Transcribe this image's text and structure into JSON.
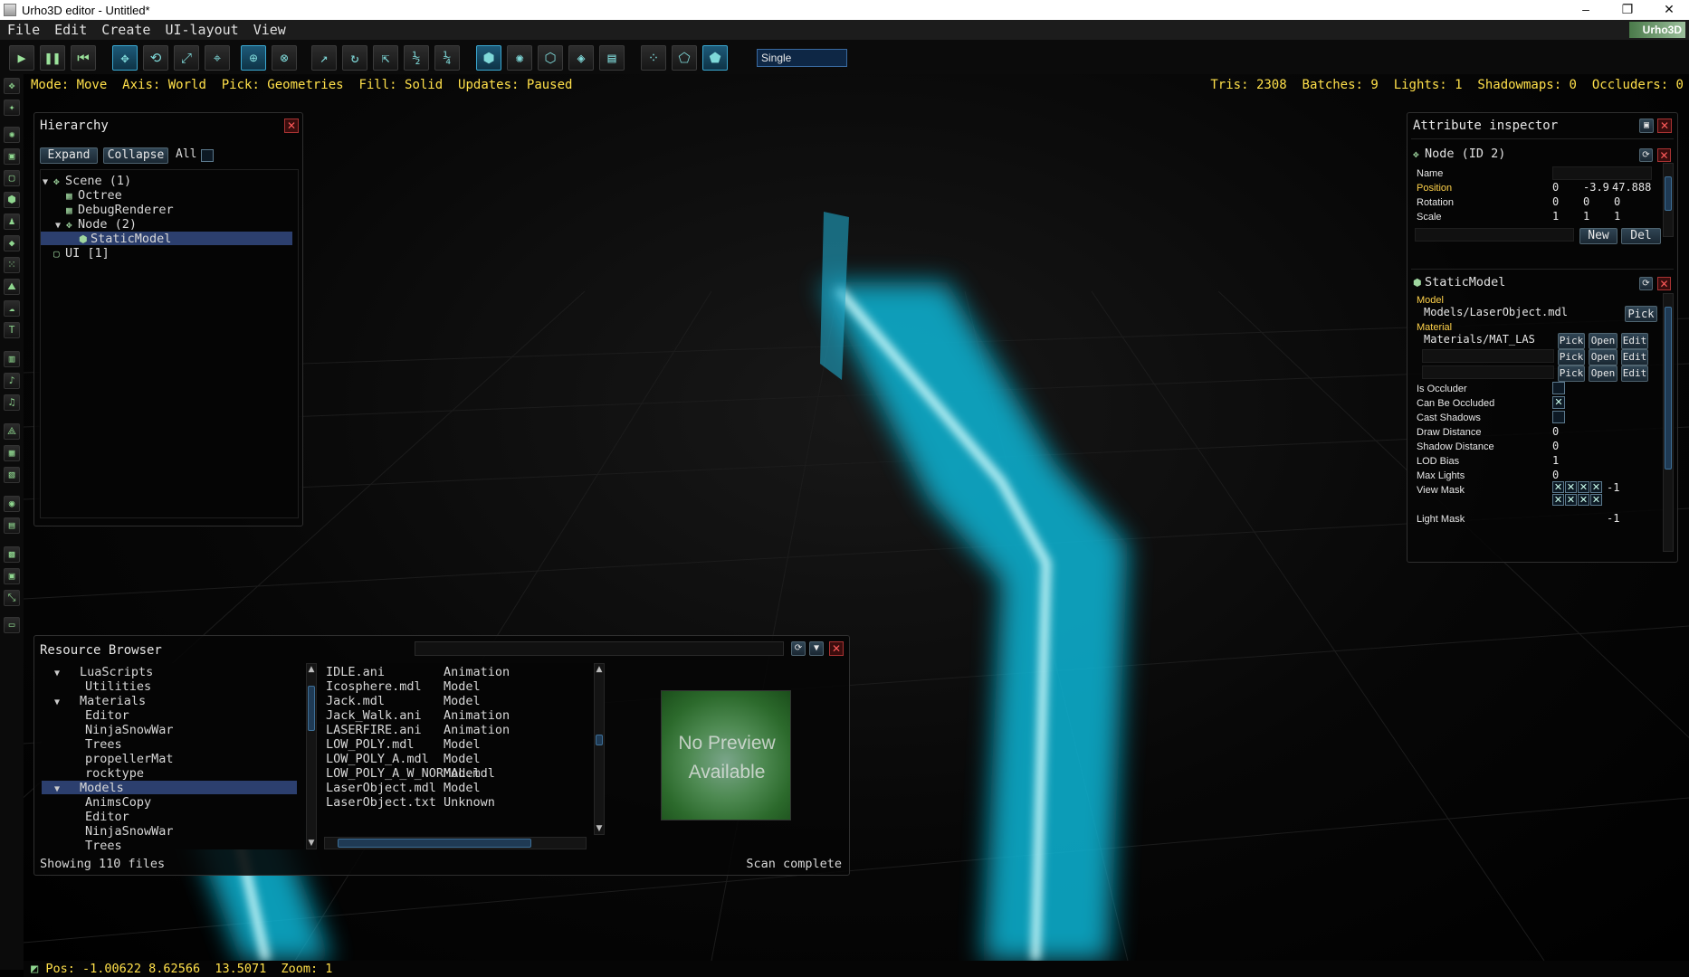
{
  "window": {
    "title": "Urho3D editor - Untitled*",
    "minimize": "–",
    "maximize": "❐",
    "close": "✕"
  },
  "menu": [
    "File",
    "Edit",
    "Create",
    "UI-layout",
    "View"
  ],
  "logo": "Urho3D",
  "toolbar": {
    "view_mode": "Single"
  },
  "status": {
    "mode": "Mode: Move",
    "axis": "Axis: World",
    "pick": "Pick: Geometries",
    "fill": "Fill: Solid",
    "updates": "Updates: Paused",
    "tris": "Tris: 2308",
    "batches": "Batches: 9",
    "lights": "Lights: 1",
    "shadowmaps": "Shadowmaps: 0",
    "occluders": "Occluders: 0"
  },
  "hierarchy": {
    "title": "Hierarchy",
    "expand": "Expand",
    "collapse": "Collapse",
    "all": "All",
    "items": [
      {
        "label": "Scene (1)",
        "icon": "scene-node-icon",
        "indent": 0,
        "expanded": true
      },
      {
        "label": "Octree",
        "icon": "component-icon",
        "indent": 1
      },
      {
        "label": "DebugRenderer",
        "icon": "component-icon",
        "indent": 1
      },
      {
        "label": "Node (2)",
        "icon": "node-icon",
        "indent": 1,
        "expanded": true
      },
      {
        "label": "StaticModel",
        "icon": "static-model-icon",
        "indent": 2,
        "selected": true
      },
      {
        "label": "UI [1]",
        "icon": "ui-element-icon",
        "indent": 0
      }
    ]
  },
  "inspector": {
    "title": "Attribute inspector",
    "node": {
      "title": "Node (ID 2)",
      "name_label": "Name",
      "name_value": "",
      "position_label": "Position",
      "position": [
        "0",
        "-3.9",
        "47.888"
      ],
      "rotation_label": "Rotation",
      "rotation": [
        "0",
        "0",
        "0"
      ],
      "scale_label": "Scale",
      "scale": [
        "1",
        "1",
        "1"
      ],
      "new": "New",
      "del": "Del"
    },
    "static_model": {
      "title": "StaticModel",
      "model_label": "Model",
      "model_value": "Models/LaserObject.mdl",
      "material_label": "Material",
      "material_value": "Materials/MAT_LAS",
      "pick": "Pick",
      "open": "Open",
      "edit": "Edit",
      "is_occluder": "Is Occluder",
      "is_occluder_checked": false,
      "can_be_occluded": "Can Be Occluded",
      "can_be_occluded_checked": true,
      "cast_shadows": "Cast Shadows",
      "cast_shadows_checked": false,
      "draw_distance": "Draw Distance",
      "draw_distance_value": "0",
      "shadow_distance": "Shadow Distance",
      "shadow_distance_value": "0",
      "lod_bias": "LOD Bias",
      "lod_bias_value": "1",
      "max_lights": "Max Lights",
      "max_lights_value": "0",
      "view_mask": "View Mask",
      "view_mask_value": "-1",
      "light_mask": "Light Mask",
      "light_mask_value": "-1"
    }
  },
  "resource_browser": {
    "title": "Resource Browser",
    "dirs": [
      {
        "label": "LuaScripts",
        "indent": 1,
        "expanded": true
      },
      {
        "label": "Utilities",
        "indent": 2
      },
      {
        "label": "Materials",
        "indent": 1,
        "expanded": true
      },
      {
        "label": "Editor",
        "indent": 2
      },
      {
        "label": "NinjaSnowWar",
        "indent": 2
      },
      {
        "label": "Trees",
        "indent": 2
      },
      {
        "label": "propellerMat",
        "indent": 2
      },
      {
        "label": "rocktype",
        "indent": 2
      },
      {
        "label": "Models",
        "indent": 1,
        "expanded": true,
        "selected": true
      },
      {
        "label": "AnimsCopy",
        "indent": 2
      },
      {
        "label": "Editor",
        "indent": 2
      },
      {
        "label": "NinjaSnowWar",
        "indent": 2
      },
      {
        "label": "Trees",
        "indent": 2
      }
    ],
    "files": [
      {
        "name": "IDLE.ani",
        "type": "Animation"
      },
      {
        "name": "Icosphere.mdl",
        "type": "Model"
      },
      {
        "name": "Jack.mdl",
        "type": "Model"
      },
      {
        "name": "Jack_Walk.ani",
        "type": "Animation"
      },
      {
        "name": "LASERFIRE.ani",
        "type": "Animation"
      },
      {
        "name": "LOW_POLY.mdl",
        "type": "Model"
      },
      {
        "name": "LOW_POLY_A.mdl",
        "type": "Model"
      },
      {
        "name": "LOW_POLY_A_W_NORMAL.mdl",
        "type": "Model"
      },
      {
        "name": "LaserObject.mdl",
        "type": "Model"
      },
      {
        "name": "LaserObject.txt",
        "type": "Unknown"
      }
    ],
    "preview_text": "No Preview Available",
    "showing": "Showing 110 files",
    "scan": "Scan complete"
  },
  "bottom": {
    "pos": "Pos: -1.00622 8.62566  13.5071",
    "zoom": "Zoom: 1"
  }
}
